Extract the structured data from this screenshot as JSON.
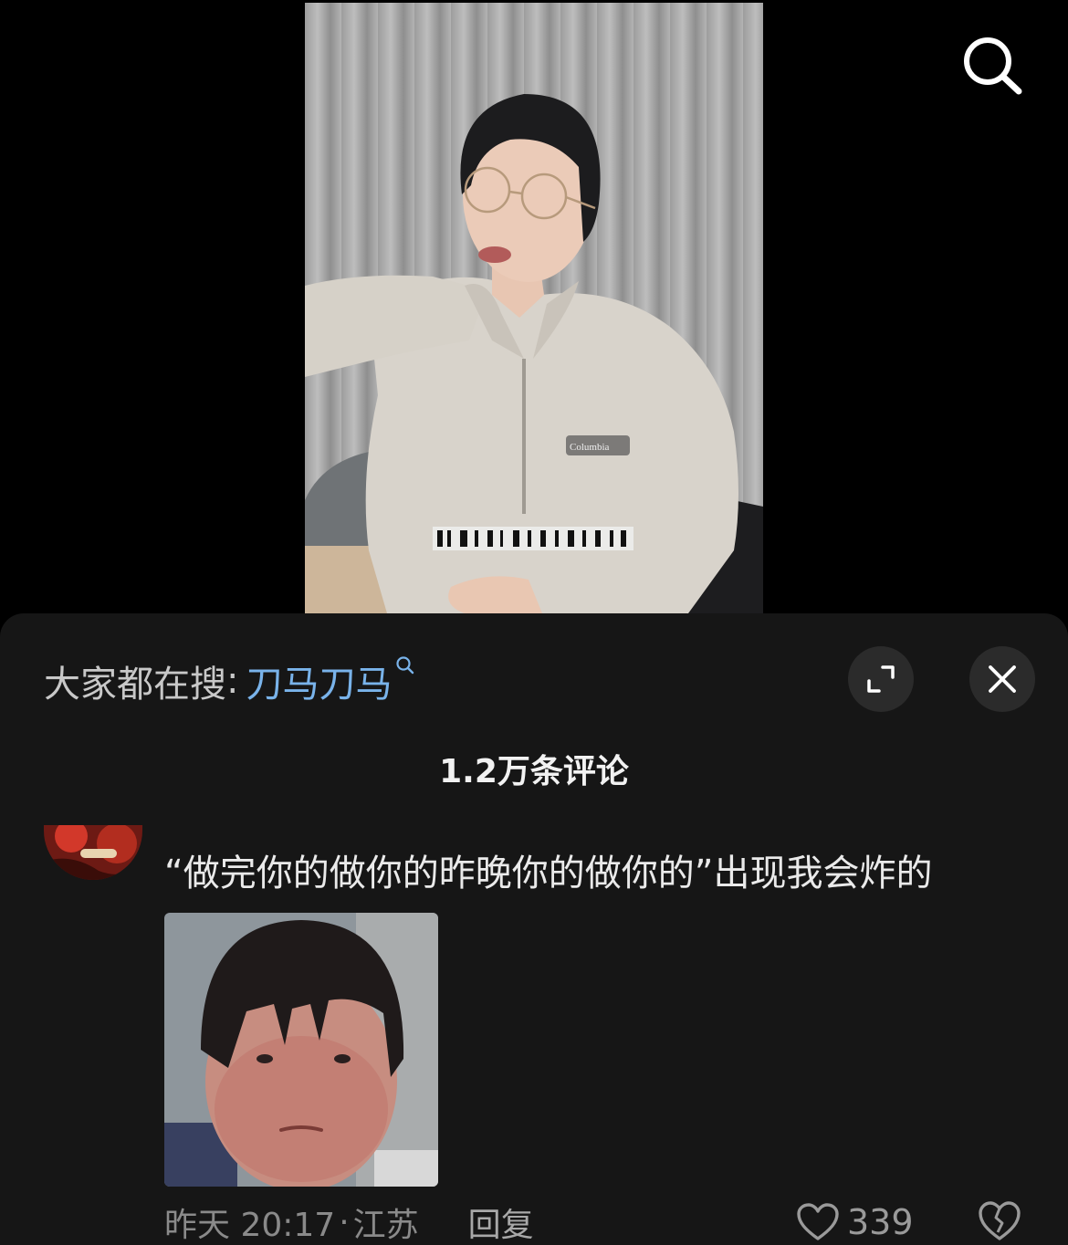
{
  "header": {
    "search_icon": "search-icon"
  },
  "video": {
    "jacket_logo": "Columbia"
  },
  "sheet": {
    "suggest_prefix": "大家都在搜",
    "suggest_colon": ":",
    "suggest_term": "刀马刀马",
    "expand_icon": "expand-icon",
    "close_icon": "close-icon",
    "comment_count": "1.2万条评论"
  },
  "comment": {
    "text": "“做完你的做你的昨晚你的做你的”出现我会炸的",
    "date": "昨天 20:17",
    "dot": "·",
    "location": "江苏",
    "reply_label": "回复",
    "like_count": "339",
    "like_icon": "heart-outline-icon",
    "dislike_icon": "broken-heart-icon"
  },
  "colors": {
    "sheet_bg": "#161616",
    "link_blue": "#79b3ea"
  }
}
